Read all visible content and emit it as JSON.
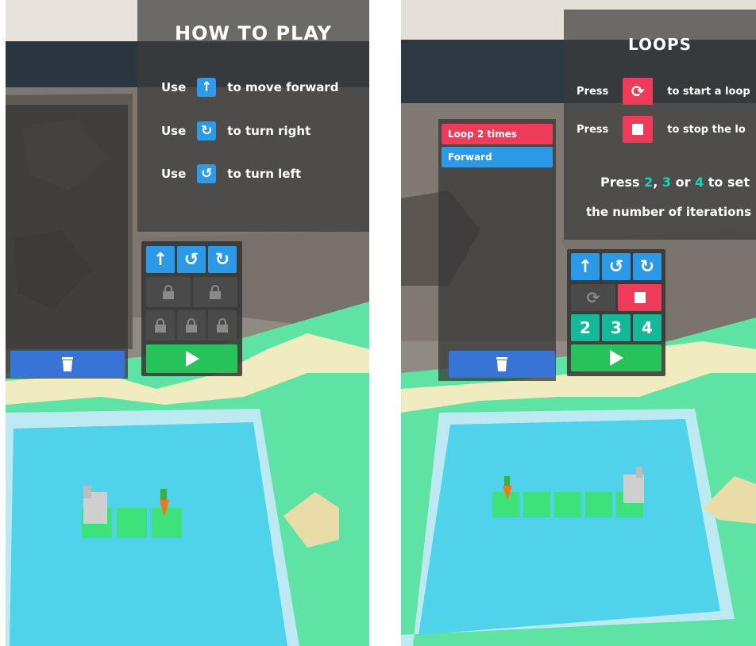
{
  "colors": {
    "accent_blue": "#2c99e6",
    "loop_red": "#ef3b5a",
    "number_teal": "#16b89a",
    "play_green": "#27c35a",
    "trash_blue": "#3873d6",
    "grass": "#5fe3a4",
    "water": "#4fd3ea"
  },
  "left": {
    "title": "HOW TO PLAY",
    "rows": [
      {
        "prefix": "Use",
        "icon": "arrow-up-icon",
        "text": "to move forward"
      },
      {
        "prefix": "Use",
        "icon": "turn-right-icon",
        "text": "to turn right"
      },
      {
        "prefix": "Use",
        "icon": "turn-left-icon",
        "text": "to turn left"
      }
    ],
    "controls": {
      "buttons": [
        "forward-button",
        "turn-left-button",
        "turn-right-button"
      ],
      "locked_count": 5,
      "run": "play-icon"
    },
    "trash": "trash-icon"
  },
  "right": {
    "title": "LOOPS",
    "rows": [
      {
        "prefix": "Press",
        "icon": "loop-icon",
        "text": "to start a loop"
      },
      {
        "prefix": "Press",
        "icon": "stop-icon",
        "text": "to stop the lo"
      }
    ],
    "iterations_line1_a": "Press ",
    "iterations_line1_n2": "2",
    "iterations_line1_c1": ", ",
    "iterations_line1_n3": "3",
    "iterations_line1_c2": " or ",
    "iterations_line1_n4": "4",
    "iterations_line1_b": " to set",
    "iterations_line2": "the number of iterations",
    "program": [
      "Loop 2 times",
      "Forward"
    ],
    "numbers": [
      "2",
      "3",
      "4"
    ],
    "trash": "trash-icon"
  }
}
